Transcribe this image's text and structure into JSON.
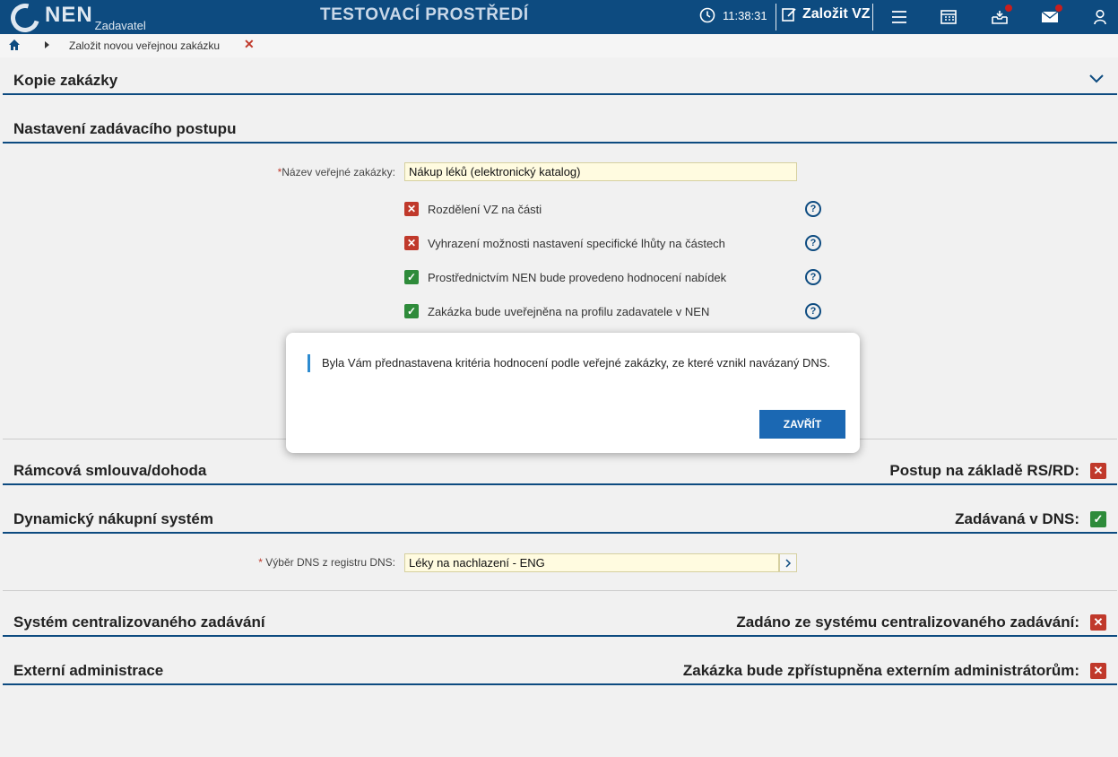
{
  "header": {
    "logo": "NEN",
    "logo_sub": "Zadavatel",
    "env_title": "TESTOVACÍ PROSTŘEDÍ",
    "clock": "11:38:31",
    "new_vz_label": "Založit VZ",
    "icons": [
      "menu-icon",
      "calendar-icon",
      "inbox-icon",
      "mail-icon",
      "user-icon"
    ]
  },
  "breadcrumb": {
    "current": "Založit novou veřejnou zakázku"
  },
  "sections": {
    "kopie": {
      "title": "Kopie zakázky"
    },
    "nastaveni": {
      "title": "Nastavení zadávacího postupu"
    },
    "ramcova": {
      "title": "Rámcová smlouva/dohoda",
      "right": "Postup na základě RS/RD:",
      "flag": "no"
    },
    "dns": {
      "title": "Dynamický nákupní systém",
      "right": "Zadávaná v DNS:",
      "flag": "yes"
    },
    "centralizovane": {
      "title": "Systém centralizovaného zadávání",
      "right": "Zadáno ze systému centralizovaného zadávání:",
      "flag": "no"
    },
    "externi": {
      "title": "Externí administrace",
      "right": "Zakázka bude zpřístupněna externím administrátorům:",
      "flag": "no"
    }
  },
  "form": {
    "nazev_label": "Název veřejné zakázky:",
    "nazev_value": "Nákup léků (elektronický katalog)",
    "checkboxes": [
      {
        "label": "Rozdělení VZ na části",
        "checked": false
      },
      {
        "label": "Vyhrazení možnosti nastavení specifické lhůty na částech",
        "checked": false
      },
      {
        "label": "Prostřednictvím NEN bude provedeno hodnocení nabídek",
        "checked": true
      },
      {
        "label": "Zakázka bude uveřejněna na profilu zadavatele v NEN",
        "checked": true
      }
    ],
    "dns_label": "Výběr DNS z registru DNS:",
    "dns_value": "Léky na nachlazení - ENG"
  },
  "modal": {
    "message": "Byla Vám přednastavena kritéria hodnocení podle veřejné zakázky, ze které vznikl navázaný DNS.",
    "button": "ZAVŘÍT"
  },
  "colors": {
    "brand": "#0d4b80",
    "button": "#1b68b3",
    "no": "#c0392b",
    "yes": "#2e8b3a"
  }
}
